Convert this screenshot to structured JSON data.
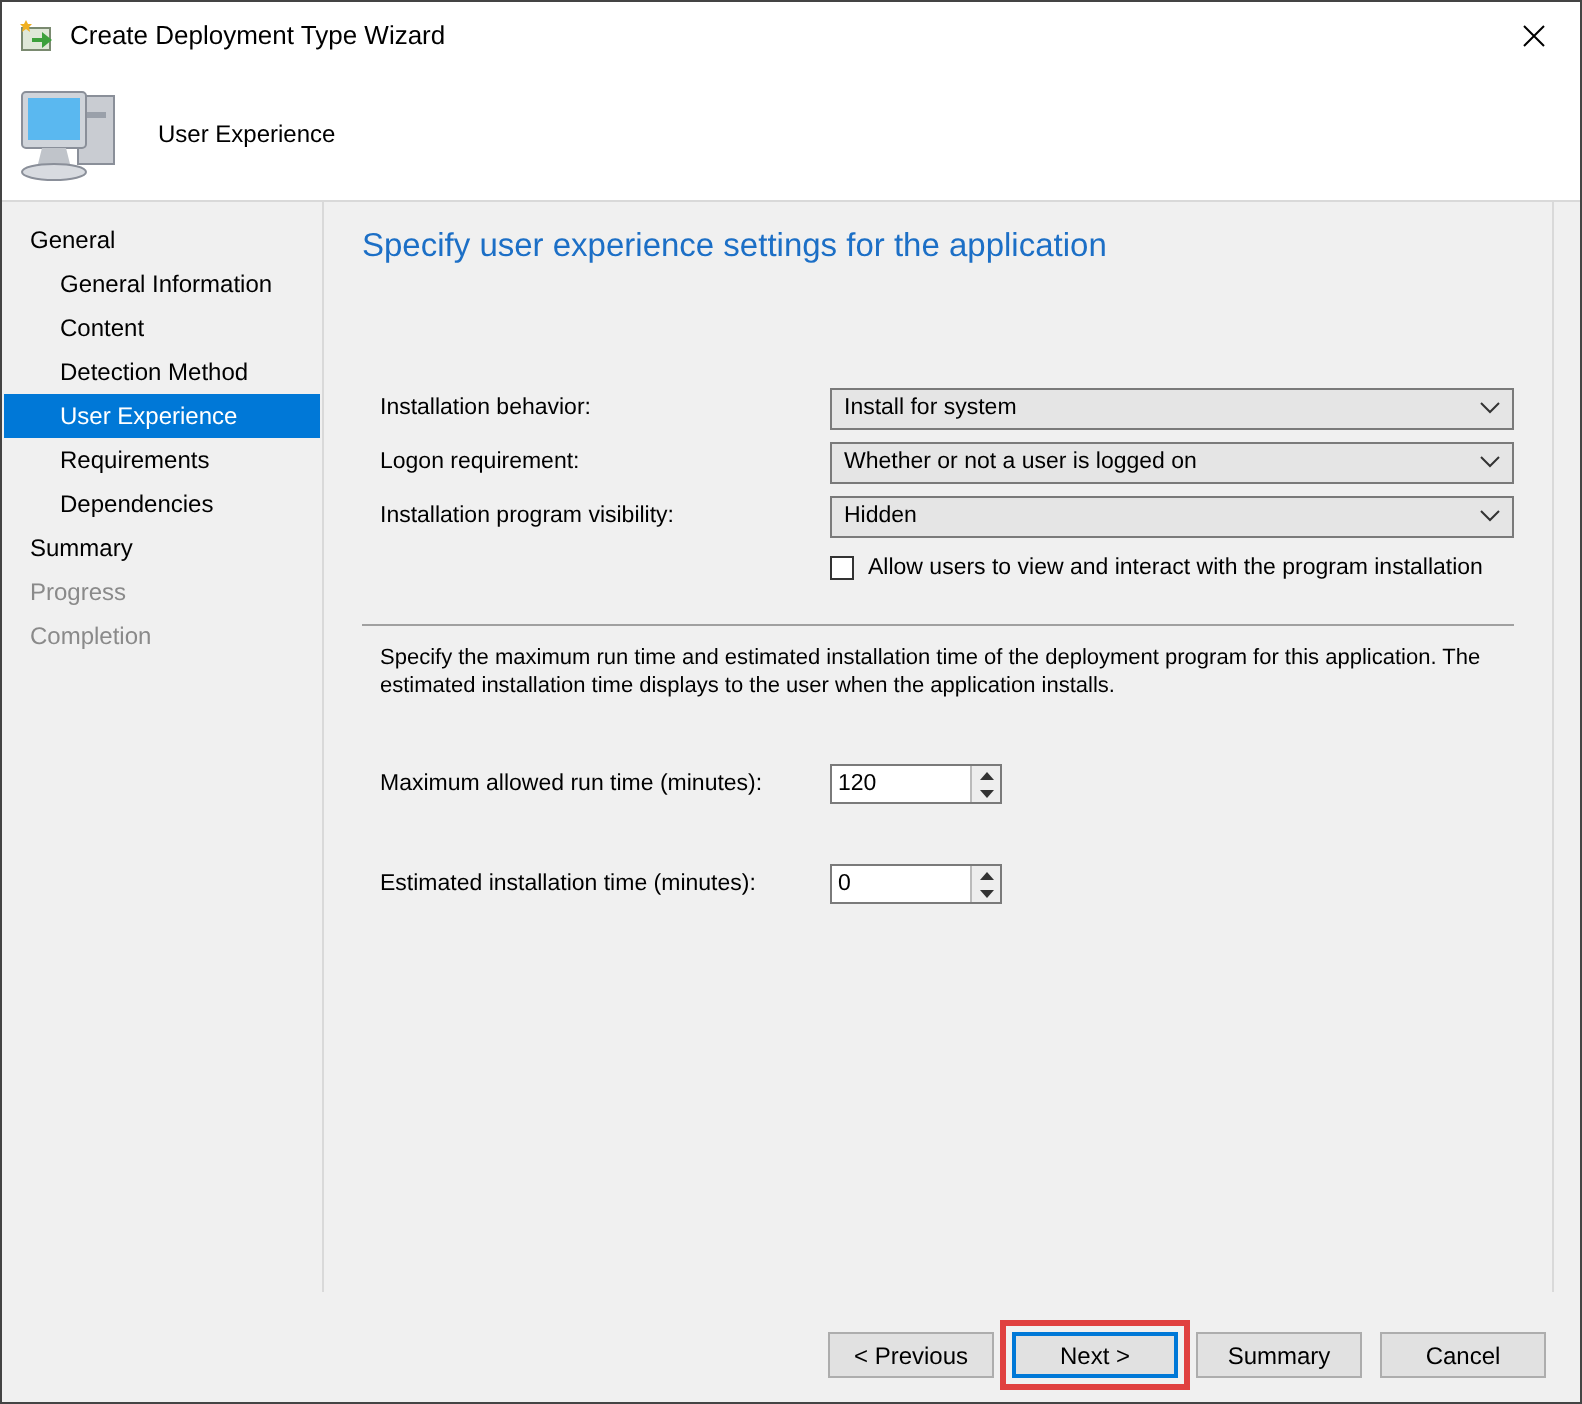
{
  "window": {
    "title": "Create Deployment Type Wizard"
  },
  "header": {
    "title": "User Experience"
  },
  "sidebar": {
    "items": [
      {
        "label": "General",
        "selected": false,
        "disabled": false,
        "children": [
          {
            "label": "General Information",
            "selected": false,
            "disabled": false
          },
          {
            "label": "Content",
            "selected": false,
            "disabled": false
          },
          {
            "label": "Detection Method",
            "selected": false,
            "disabled": false
          },
          {
            "label": "User Experience",
            "selected": true,
            "disabled": false
          },
          {
            "label": "Requirements",
            "selected": false,
            "disabled": false
          },
          {
            "label": "Dependencies",
            "selected": false,
            "disabled": false
          }
        ]
      },
      {
        "label": "Summary",
        "selected": false,
        "disabled": false
      },
      {
        "label": "Progress",
        "selected": false,
        "disabled": true
      },
      {
        "label": "Completion",
        "selected": false,
        "disabled": true
      }
    ]
  },
  "content": {
    "heading": "Specify user experience settings for the application",
    "settings": [
      {
        "label": "Installation behavior:",
        "value": "Install for system"
      },
      {
        "label": "Logon requirement:",
        "value": "Whether or not a user is logged on"
      },
      {
        "label": "Installation program visibility:",
        "value": "Hidden"
      }
    ],
    "checkbox": {
      "label": "Allow users to view and interact with the program installation",
      "checked": false
    },
    "description": "Specify the maximum run time and estimated installation time of the deployment program for this application. The estimated installation time displays to the user when the application installs.",
    "spinners": [
      {
        "label": "Maximum allowed run time (minutes):",
        "value": "120"
      },
      {
        "label": "Estimated installation time (minutes):",
        "value": "0"
      }
    ]
  },
  "buttons": [
    {
      "label": "< Previous",
      "focused": false,
      "highlighted": false
    },
    {
      "label": "Next >",
      "focused": true,
      "highlighted": true
    },
    {
      "label": "Summary",
      "focused": false,
      "highlighted": false
    },
    {
      "label": "Cancel",
      "focused": false,
      "highlighted": false
    }
  ]
}
